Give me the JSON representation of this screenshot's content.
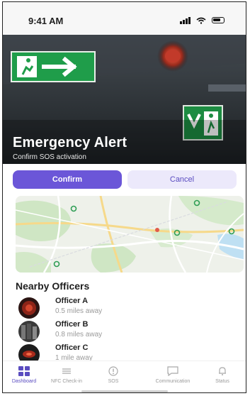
{
  "status_bar": {
    "time": "9:41 AM"
  },
  "hero": {
    "title": "Emergency Alert",
    "subtitle": "Confirm SOS activation"
  },
  "actions": {
    "confirm_label": "Confirm",
    "cancel_label": "Cancel"
  },
  "officers": {
    "section_title": "Nearby Officers",
    "items": [
      {
        "name": "Officer A",
        "distance": "0.5 miles away"
      },
      {
        "name": "Officer B",
        "distance": "0.8 miles away"
      },
      {
        "name": "Officer C",
        "distance": "1 mile away"
      }
    ]
  },
  "nav": {
    "items": [
      {
        "label": "Dashboard",
        "icon": "dashboard-icon",
        "active": true
      },
      {
        "label": "NFC Check-in",
        "icon": "nfc-icon",
        "active": false
      },
      {
        "label": "SOS",
        "icon": "sos-icon",
        "active": false
      },
      {
        "label": "Communication",
        "icon": "chat-icon",
        "active": false
      },
      {
        "label": "Status",
        "icon": "bell-icon",
        "active": false
      }
    ]
  },
  "colors": {
    "accent": "#6b56d8",
    "accent_light": "#ece9fb",
    "exit_sign_green": "#1f9d4a"
  }
}
